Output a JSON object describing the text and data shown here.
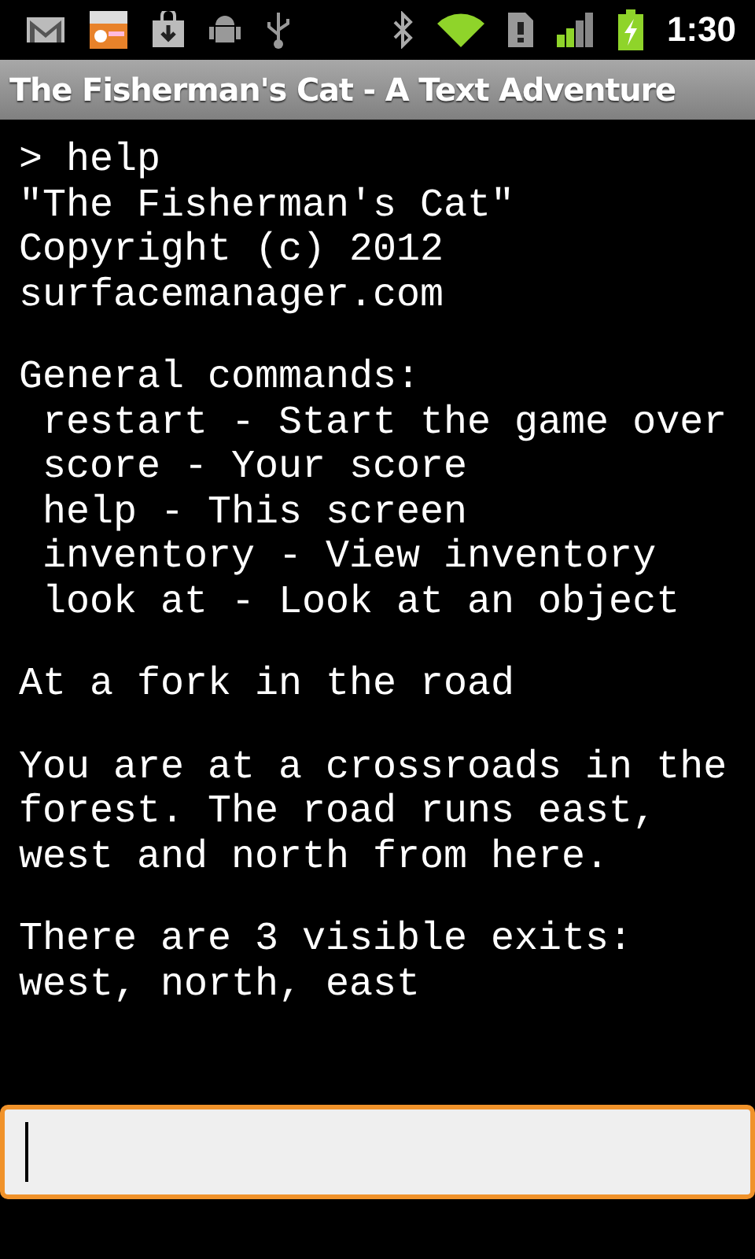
{
  "status_bar": {
    "time": "1:30"
  },
  "window": {
    "title": "The Fisherman's Cat - A Text Adventure"
  },
  "transcript": [
    [
      "> help",
      "\"The Fisherman's Cat\"",
      "Copyright (c) 2012",
      "surfacemanager.com"
    ],
    [
      "General commands:",
      " restart - Start the game over",
      " score - Your score",
      " help - This screen",
      " inventory - View inventory",
      " look at - Look at an object"
    ],
    [
      "At a fork in the road"
    ],
    [
      "You are at a crossroads in the",
      "forest. The road runs east,",
      "west and north from here."
    ],
    [
      "There are 3 visible exits:",
      "west, north, east"
    ]
  ],
  "command_input": {
    "focused": true
  }
}
